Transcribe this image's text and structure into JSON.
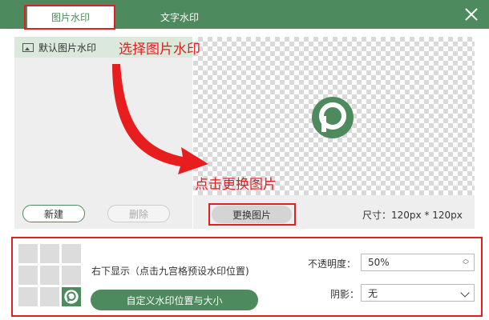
{
  "tabs": [
    {
      "label": "图片水印",
      "active": true
    },
    {
      "label": "文字水印",
      "active": false
    }
  ],
  "watermark_list": {
    "items": [
      {
        "label": "默认图片水印",
        "icon": "image-icon"
      }
    ],
    "new_label": "新建",
    "delete_label": "删除"
  },
  "preview": {
    "change_label": "更换图片",
    "size_text": "尺寸：120px * 120px"
  },
  "annotations": {
    "select": "选择图片水印",
    "change": "点击更换图片"
  },
  "position": {
    "text": "右下显示（点击九宫格预设水印位置)",
    "selected_cell": "bottom-right",
    "custom_label": "自定义水印位置与大小"
  },
  "opacity": {
    "label": "不透明度：",
    "value": "50%"
  },
  "shadow": {
    "label": "阴影：",
    "value": "无"
  },
  "colors": {
    "accent": "#4d8a5d",
    "highlight": "#e02020"
  }
}
